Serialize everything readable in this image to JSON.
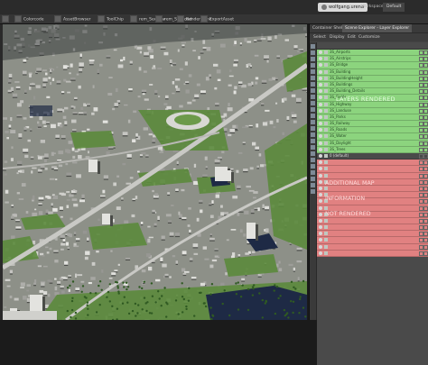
{
  "titlebar": {
    "user": "wolfgang.urena",
    "workspaces": "Workspaces:",
    "workspace_value": "Default"
  },
  "toolbar": {
    "items": [
      "Colorcode",
      "AssetBrowser",
      "ToolChip",
      "rem_SeeSaw",
      "rem_SunLoad",
      "RenderPlane",
      "ExportAsset"
    ]
  },
  "explorer": {
    "tabs": [
      "Container Shelf",
      "Scene Explorer - Layer Explorer"
    ],
    "menu": [
      "Select",
      "Display",
      "Edit",
      "Customize"
    ],
    "header": "Name (Sorted Ascending)",
    "rendered_layers": [
      "3S_Airports",
      "3S_Airstrips",
      "3S_Bridge",
      "3S_Building",
      "3S_BuildingHeight",
      "3S_Buildings",
      "3S_Building_Details",
      "3S_Fields",
      "3S_Highway",
      "3S_Landuse",
      "3S_Parks",
      "3S_Railway",
      "3S_Roads",
      "3S_Water",
      "3S_Daylight",
      "3S_Trees"
    ],
    "default_layer": "0 (default)",
    "unrendered_rows": 15,
    "label_rendered": "LAYERS RENDERED",
    "label_additional": [
      "ADDITIONAL MAP",
      "INFORMATION",
      "NOT RENDERED"
    ]
  },
  "colors": {
    "rendered": "#8cd47e",
    "not_rendered": "#e18181",
    "vegetation": "#5b8a3c",
    "water": "#1e2a45"
  }
}
